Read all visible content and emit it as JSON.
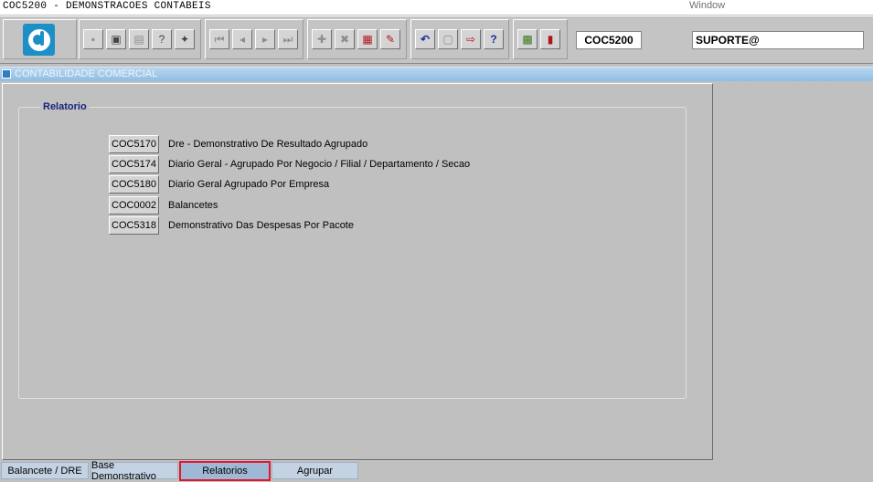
{
  "window": {
    "title": "COC5200 - DEMONSTRACOES CONTABEIS",
    "menu_window": "Window"
  },
  "toolbar": {
    "form_code": "COC5200",
    "user": "SUPORTE@",
    "icons": [
      "save-icon",
      "window-icon",
      "print-icon",
      "help-query-icon",
      "execute-query-icon",
      "first-record-icon",
      "prev-record-icon",
      "next-record-icon",
      "last-record-icon",
      "insert-record-icon",
      "delete-record-icon",
      "clear-record-icon",
      "edit-icon",
      "undo-icon",
      "calculator-icon",
      "export-icon",
      "help-icon",
      "report-icon",
      "exit-icon"
    ]
  },
  "header": {
    "title": "CONTABILIDADE COMERCIAL"
  },
  "relatorio": {
    "title": "Relatorio",
    "items": [
      {
        "code": "COC5170",
        "label": "Dre - Demonstrativo De Resultado Agrupado"
      },
      {
        "code": "COC5174",
        "label": "Diario Geral - Agrupado Por Negocio / Filial / Departamento / Secao"
      },
      {
        "code": "COC5180",
        "label": "Diario Geral Agrupado Por Empresa"
      },
      {
        "code": "COC0002",
        "label": "Balancetes"
      },
      {
        "code": "COC5318",
        "label": "Demonstrativo Das Despesas Por Pacote"
      }
    ]
  },
  "tabs": [
    {
      "label": "Balancete / DRE",
      "active": false
    },
    {
      "label": "Base Demonstrativo",
      "active": false
    },
    {
      "label": "Relatorios",
      "active": true
    },
    {
      "label": "Agrupar",
      "active": false
    }
  ]
}
